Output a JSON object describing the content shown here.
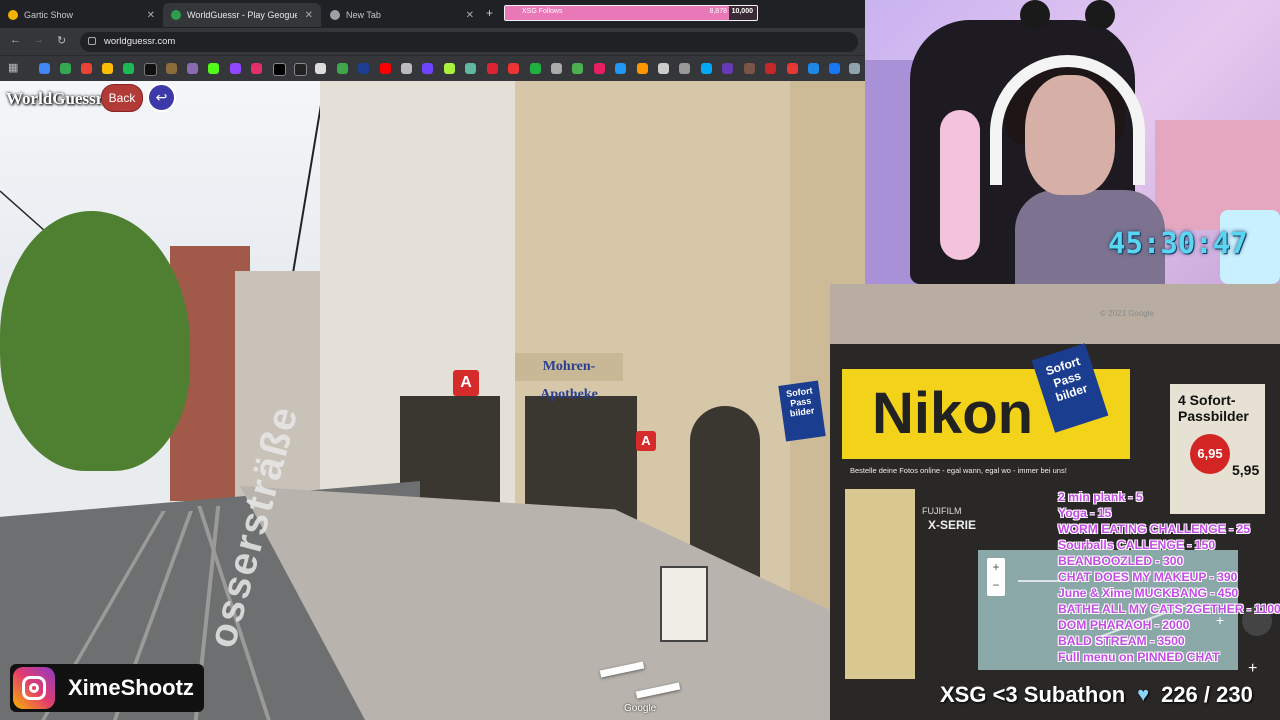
{
  "browser": {
    "tabs": [
      {
        "title": "Gartic Show",
        "active": false,
        "favicon_color": "#f2b400"
      },
      {
        "title": "WorldGuessr - Play Geoguessr F",
        "active": true,
        "favicon_color": "#2e9d4e"
      },
      {
        "title": "New Tab",
        "active": false,
        "favicon_color": "#9aa0a6"
      }
    ],
    "new_tab_icon": "plus-icon",
    "url": "worldguessr.com"
  },
  "follow_goal": {
    "label": "XSG Follows",
    "current": "8,878",
    "goal": "10,000",
    "progress": 0.8878,
    "fill_color": "#e878b8"
  },
  "game": {
    "logo": "WorldGuessr",
    "back_label": "Back",
    "return_icon": "return-arrow-icon",
    "street_name": "ossersträße",
    "shop_signs": {
      "pharmacy": "Mohren-Apotheke",
      "nikon": "Nikon",
      "pass": "Sofort Pass bilder",
      "pass_right": "4 Sofort- Passbilder",
      "price": "6,95",
      "price2": "5,95",
      "xserie": "X-SERIE",
      "fujifilm": "FUJIFILM",
      "slogan": "Bestelle deine Fotos online - egal wann, egal wo - immer bei uns!",
      "copyright": "© 2023 Google"
    },
    "google_label": "Google"
  },
  "stream": {
    "timer": "45:30:47",
    "menu": [
      "2 min plank - 5",
      "Yoga - 15",
      "WORM EATING CHALLENGE - 25",
      "Sourballs CALLENGE - 150",
      "BEANBOOZLED - 300",
      "CHAT DOES MY MAKEUP - 390",
      "June & Xime MUCKBANG - 450",
      "BATHE ALL MY CATS 2GETHER - 1100",
      "DOM PHARAOH - 2000",
      "BALD STREAM - 3500",
      "Full menu on PINNED CHAT"
    ],
    "subathon_label": "XSG <3 Subathon",
    "subathon_count": "226 / 230",
    "instagram_handle": "XimeShootz",
    "menu_color": "#c44ce6",
    "timer_color": "#58d6f2"
  },
  "map": {
    "zoom_in": "+",
    "zoom_out": "−",
    "expand": "+"
  }
}
